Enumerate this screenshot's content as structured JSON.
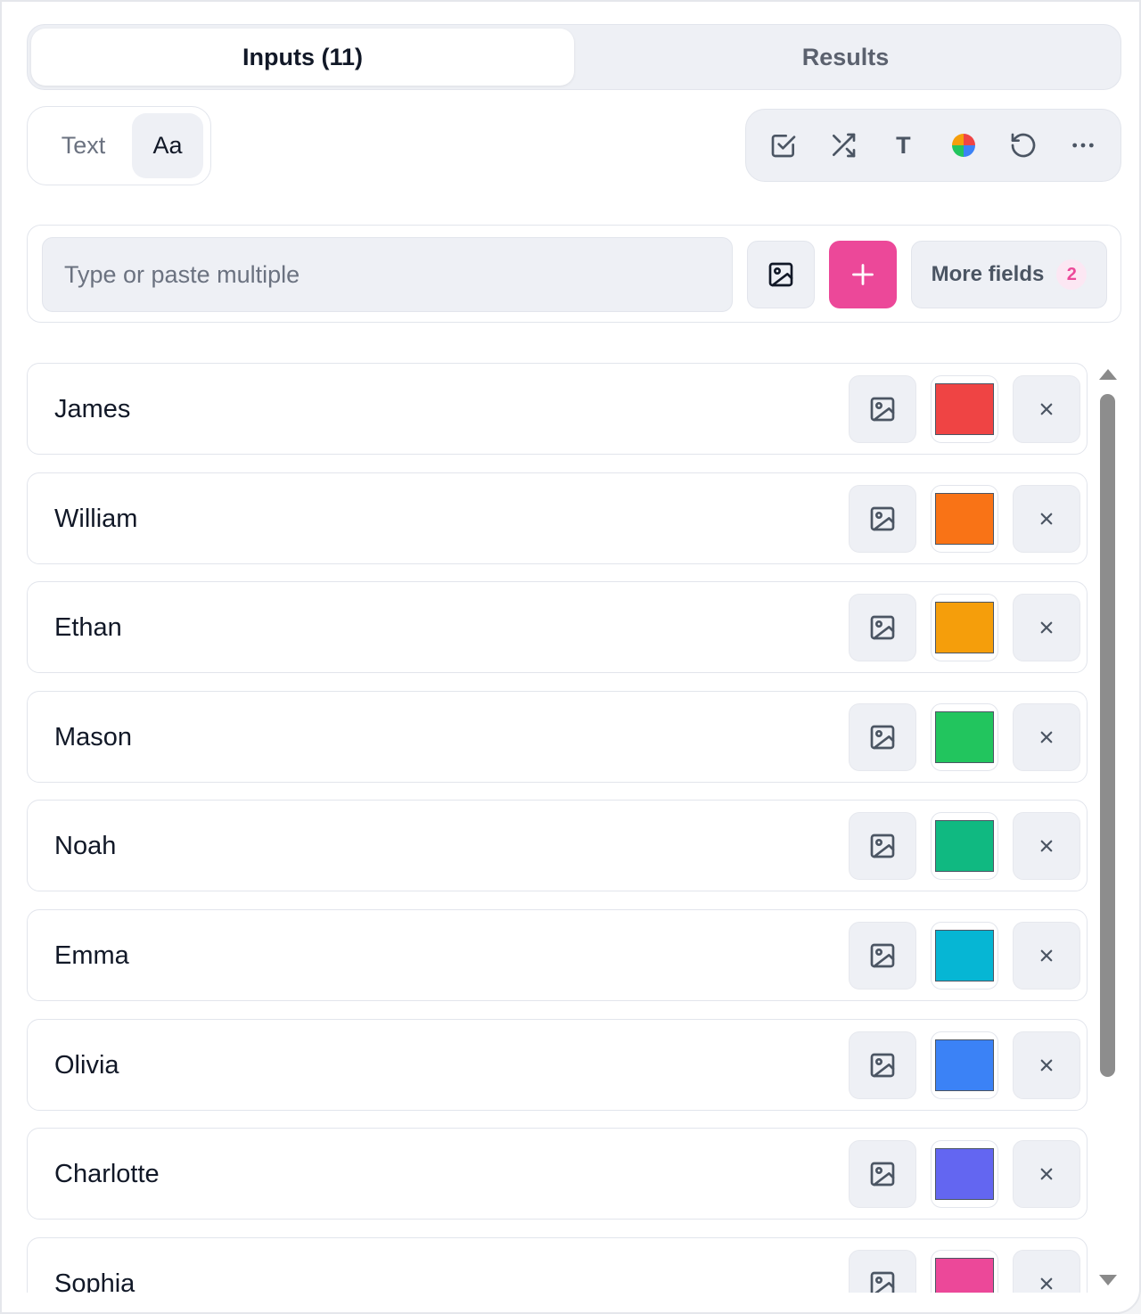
{
  "tabs": [
    {
      "label": "Inputs (11)",
      "active": true
    },
    {
      "label": "Results",
      "active": false
    }
  ],
  "mode": {
    "text_label": "Text",
    "aa_label": "Aa",
    "selected": "Aa"
  },
  "toolbar": {
    "items": [
      "checkbox-icon",
      "shuffle-icon",
      "text-T-icon",
      "color-wheel-icon",
      "reset-icon",
      "more-icon"
    ],
    "text_glyph": "T"
  },
  "entry": {
    "placeholder": "Type or paste multiple",
    "add_label": "+",
    "more_fields_label": "More fields",
    "more_fields_count": "2"
  },
  "items": [
    {
      "name": "James",
      "color": "#ef4444"
    },
    {
      "name": "William",
      "color": "#f97316"
    },
    {
      "name": "Ethan",
      "color": "#f59e0b"
    },
    {
      "name": "Mason",
      "color": "#22c55e"
    },
    {
      "name": "Noah",
      "color": "#10b981"
    },
    {
      "name": "Emma",
      "color": "#06b6d4"
    },
    {
      "name": "Olivia",
      "color": "#3b82f6"
    },
    {
      "name": "Charlotte",
      "color": "#6366f1"
    },
    {
      "name": "Sophia",
      "color": "#ec4899"
    }
  ],
  "delete_glyph": "×",
  "colors": {
    "accent": "#ec4899",
    "badge_bg": "#fce7f3"
  }
}
